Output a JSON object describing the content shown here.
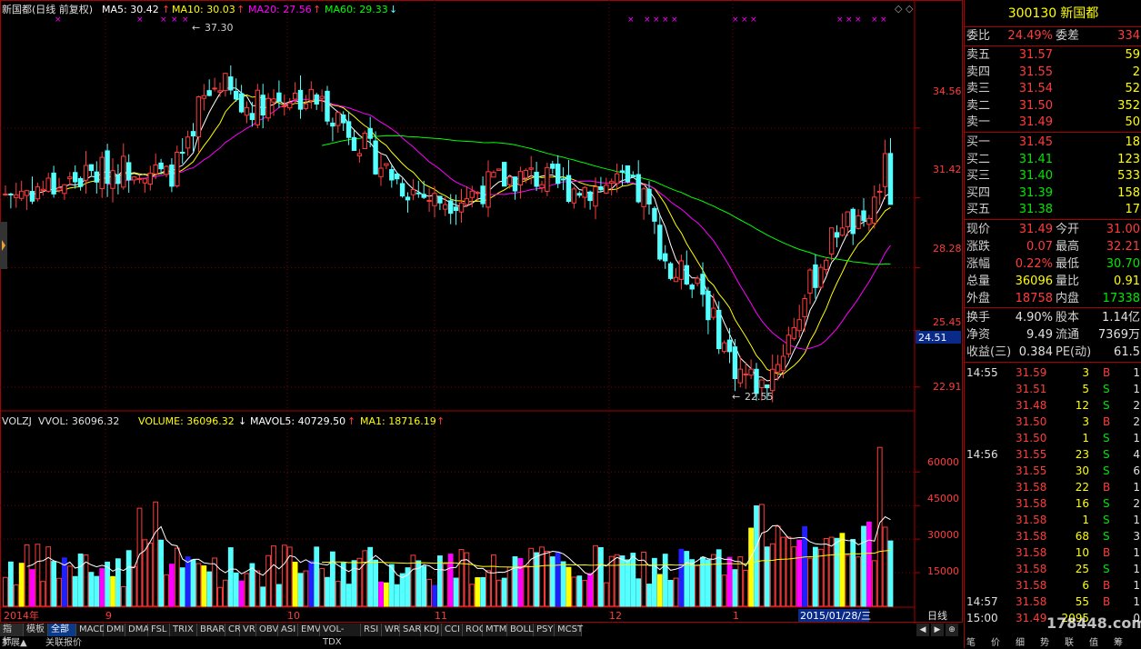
{
  "chart": {
    "title_prefix": "新国都(日线 前复权)",
    "ma5_label": "MA5: 30.42",
    "ma10_label": "MA10: 30.03",
    "ma20_label": "MA20: 27.56",
    "ma60_label": "MA60: 29.33",
    "high_marker": "37.30",
    "low_marker": "22.55",
    "price_ticks": [
      "34.56",
      "31.42",
      "28.28",
      "25.45",
      "22.91"
    ],
    "current_price_tag": "24.51",
    "volume_header": {
      "volzj": "VOLZJ",
      "vvol": "VVOL: 36096.32",
      "volume": "VOLUME: 36096.32",
      "mavol5": "MAVOL5: 40729.50",
      "ma1": "MA1: 18716.19"
    },
    "volume_ticks": [
      "60000",
      "45000",
      "30000",
      "15000"
    ],
    "date_labels": [
      "2014年",
      "9",
      "10",
      "11",
      "12",
      "1",
      "2015/01/28/三"
    ],
    "period_label": "日线",
    "colors": {
      "up": "#ff3c3c",
      "down": "#54ffff",
      "ma5": "#ffffff",
      "ma10": "#ffff00",
      "ma20": "#ff00ff",
      "ma60": "#00ff00"
    }
  },
  "chart_data": {
    "type": "line",
    "title": "新国都(日线 前复权)",
    "series": [
      {
        "name": "MA5",
        "values": [
          30.42
        ]
      },
      {
        "name": "MA10",
        "values": [
          30.03
        ]
      },
      {
        "name": "MA20",
        "values": [
          27.56
        ]
      },
      {
        "name": "MA60",
        "values": [
          29.33
        ]
      }
    ],
    "yticks": [
      34.56,
      31.42,
      28.28,
      25.45,
      22.91
    ],
    "ylim": [
      22.0,
      39.5
    ],
    "high": 37.3,
    "low": 22.55,
    "volume_yticks": [
      60000,
      45000,
      30000,
      15000
    ]
  },
  "toolbar_tabs": [
    "指标",
    "模板",
    "全部",
    "MACD",
    "DMI",
    "DMA",
    "FSL",
    "TRIX",
    "BRAR",
    "CR",
    "VR",
    "OBV",
    "ASI",
    "EMV",
    "VOL-TDX",
    "RSI",
    "WR",
    "SAR",
    "KDJ",
    "CCI",
    "ROC",
    "MTM",
    "BOLL",
    "PSY",
    "MCST"
  ],
  "bottom_tabs": [
    "扩展▲",
    "关联报价"
  ],
  "side": {
    "code": "300130",
    "name": "新国都",
    "weibi_label": "委比",
    "weibi": "24.49%",
    "weicha_label": "委差",
    "weicha": "334",
    "asks": [
      {
        "label": "卖五",
        "price": "31.57",
        "vol": "59"
      },
      {
        "label": "卖四",
        "price": "31.55",
        "vol": "2"
      },
      {
        "label": "卖三",
        "price": "31.54",
        "vol": "52"
      },
      {
        "label": "卖二",
        "price": "31.50",
        "vol": "352"
      },
      {
        "label": "卖一",
        "price": "31.49",
        "vol": "50"
      }
    ],
    "bids": [
      {
        "label": "买一",
        "price": "31.45",
        "vol": "18"
      },
      {
        "label": "买二",
        "price": "31.41",
        "vol": "123"
      },
      {
        "label": "买三",
        "price": "31.40",
        "vol": "533"
      },
      {
        "label": "买四",
        "price": "31.39",
        "vol": "158"
      },
      {
        "label": "买五",
        "price": "31.38",
        "vol": "17"
      }
    ],
    "quote": [
      {
        "l1": "现价",
        "v1": "31.49",
        "c1": "red",
        "l2": "今开",
        "v2": "31.00",
        "c2": "red"
      },
      {
        "l1": "涨跌",
        "v1": "0.07",
        "c1": "red",
        "l2": "最高",
        "v2": "32.21",
        "c2": "red"
      },
      {
        "l1": "涨幅",
        "v1": "0.22%",
        "c1": "red",
        "l2": "最低",
        "v2": "30.70",
        "c2": "grn"
      },
      {
        "l1": "总量",
        "v1": "36096",
        "c1": "yel",
        "l2": "量比",
        "v2": "0.91",
        "c2": "yel"
      },
      {
        "l1": "外盘",
        "v1": "18758",
        "c1": "red",
        "l2": "内盘",
        "v2": "17338",
        "c2": "grn"
      }
    ],
    "stats": [
      {
        "l1": "换手",
        "v1": "4.90%",
        "l2": "股本",
        "v2": "1.14亿"
      },
      {
        "l1": "净资",
        "v1": "9.49",
        "l2": "流通",
        "v2": "7369万"
      },
      {
        "l1": "收益(三)",
        "v1": "0.384",
        "l2": "PE(动)",
        "v2": "61.5"
      }
    ],
    "ticks": [
      {
        "time": "14:55",
        "price": "31.59",
        "vol": "3",
        "bs": "B",
        "n": "1"
      },
      {
        "time": "",
        "price": "31.51",
        "vol": "5",
        "bs": "S",
        "n": "1"
      },
      {
        "time": "",
        "price": "31.48",
        "vol": "12",
        "bs": "S",
        "n": "2"
      },
      {
        "time": "",
        "price": "31.50",
        "vol": "3",
        "bs": "B",
        "n": "2"
      },
      {
        "time": "",
        "price": "31.50",
        "vol": "1",
        "bs": "S",
        "n": "1"
      },
      {
        "time": "14:56",
        "price": "31.55",
        "vol": "23",
        "bs": "S",
        "n": "4"
      },
      {
        "time": "",
        "price": "31.55",
        "vol": "30",
        "bs": "S",
        "n": "6"
      },
      {
        "time": "",
        "price": "31.58",
        "vol": "22",
        "bs": "B",
        "n": "1"
      },
      {
        "time": "",
        "price": "31.58",
        "vol": "16",
        "bs": "S",
        "n": "2"
      },
      {
        "time": "",
        "price": "31.58",
        "vol": "1",
        "bs": "S",
        "n": "1"
      },
      {
        "time": "",
        "price": "31.58",
        "vol": "68",
        "bs": "S",
        "n": "3"
      },
      {
        "time": "",
        "price": "31.58",
        "vol": "10",
        "bs": "B",
        "n": "1"
      },
      {
        "time": "",
        "price": "31.58",
        "vol": "25",
        "bs": "S",
        "n": "1"
      },
      {
        "time": "",
        "price": "31.58",
        "vol": "6",
        "bs": "B",
        "n": "1"
      },
      {
        "time": "14:57",
        "price": "31.58",
        "vol": "55",
        "bs": "B",
        "n": "1"
      },
      {
        "time": "15:00",
        "price": "31.49",
        "vol": "2095",
        "bs": "",
        "n": "0"
      }
    ],
    "bottom_tabs": [
      "笔",
      "价",
      "细",
      "势",
      "联",
      "值",
      "筹"
    ],
    "watermark": "178448.com"
  }
}
